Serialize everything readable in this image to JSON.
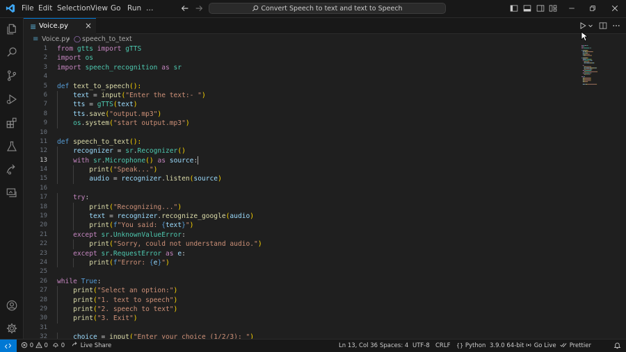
{
  "menu": [
    "File",
    "Edit",
    "Selection",
    "View",
    "Go",
    "Run"
  ],
  "more_menu": "…",
  "command_center": {
    "text": "Convert Speech to text and text to Speech"
  },
  "tab": {
    "label": "Voice.py",
    "close": "×"
  },
  "breadcrumb": {
    "file": "Voice.py",
    "separator": "›",
    "symbol": "speech_to_text"
  },
  "editor": {
    "current_line": 13,
    "line_numbers": [
      "1",
      "2",
      "3",
      "4",
      "5",
      "6",
      "7",
      "8",
      "9",
      "10",
      "11",
      "12",
      "13",
      "14",
      "15",
      "16",
      "17",
      "18",
      "19",
      "20",
      "21",
      "22",
      "23",
      "24",
      "25",
      "26",
      "27",
      "28",
      "29",
      "30",
      "31",
      "32"
    ],
    "lines": [
      [
        [
          "kw",
          "from"
        ],
        [
          "tx",
          " "
        ],
        [
          "cl",
          "gtts"
        ],
        [
          "tx",
          " "
        ],
        [
          "kw",
          "import"
        ],
        [
          "tx",
          " "
        ],
        [
          "cl",
          "gTTS"
        ]
      ],
      [
        [
          "kw",
          "import"
        ],
        [
          "tx",
          " "
        ],
        [
          "cl",
          "os"
        ]
      ],
      [
        [
          "kw",
          "import"
        ],
        [
          "tx",
          " "
        ],
        [
          "cl",
          "speech_recognition"
        ],
        [
          "tx",
          " "
        ],
        [
          "kw",
          "as"
        ],
        [
          "tx",
          " "
        ],
        [
          "cl",
          "sr"
        ]
      ],
      [],
      [
        [
          "def",
          "def"
        ],
        [
          "tx",
          " "
        ],
        [
          "fn",
          "text_to_speech"
        ],
        [
          "bk",
          "():"
        ]
      ],
      [
        [
          "tx",
          "    "
        ],
        [
          "vr",
          "text"
        ],
        [
          "tx",
          " = "
        ],
        [
          "fn",
          "input"
        ],
        [
          "bk",
          "("
        ],
        [
          "st",
          "\"Enter the text:- \""
        ],
        [
          "bk",
          ")"
        ]
      ],
      [
        [
          "tx",
          "    "
        ],
        [
          "vr",
          "tts"
        ],
        [
          "tx",
          " = "
        ],
        [
          "cl",
          "gTTS"
        ],
        [
          "bk",
          "("
        ],
        [
          "vr",
          "text"
        ],
        [
          "bk",
          ")"
        ]
      ],
      [
        [
          "tx",
          "    "
        ],
        [
          "vr",
          "tts"
        ],
        [
          "tx",
          "."
        ],
        [
          "fn",
          "save"
        ],
        [
          "bk",
          "("
        ],
        [
          "st",
          "\"output.mp3\""
        ],
        [
          "bk",
          ")"
        ]
      ],
      [
        [
          "tx",
          "    "
        ],
        [
          "cl",
          "os"
        ],
        [
          "tx",
          "."
        ],
        [
          "fn",
          "system"
        ],
        [
          "bk",
          "("
        ],
        [
          "st",
          "\"start output.mp3\""
        ],
        [
          "bk",
          ")"
        ]
      ],
      [],
      [
        [
          "def",
          "def"
        ],
        [
          "tx",
          " "
        ],
        [
          "fn",
          "speech_to_text"
        ],
        [
          "bk",
          "():"
        ]
      ],
      [
        [
          "tx",
          "    "
        ],
        [
          "vr",
          "recognizer"
        ],
        [
          "tx",
          " = "
        ],
        [
          "cl",
          "sr"
        ],
        [
          "tx",
          "."
        ],
        [
          "cl",
          "Recognizer"
        ],
        [
          "bk",
          "()"
        ]
      ],
      [
        [
          "tx",
          "    "
        ],
        [
          "kw",
          "with"
        ],
        [
          "tx",
          " "
        ],
        [
          "cl",
          "sr"
        ],
        [
          "tx",
          "."
        ],
        [
          "cl",
          "Microphone"
        ],
        [
          "bk",
          "()"
        ],
        [
          "tx",
          " "
        ],
        [
          "kw",
          "as"
        ],
        [
          "tx",
          " "
        ],
        [
          "vr",
          "source"
        ],
        [
          "tx",
          ":"
        ]
      ],
      [
        [
          "tx",
          "        "
        ],
        [
          "fn",
          "print"
        ],
        [
          "bk",
          "("
        ],
        [
          "st",
          "\"Speak...\""
        ],
        [
          "bk",
          ")"
        ]
      ],
      [
        [
          "tx",
          "        "
        ],
        [
          "vr",
          "audio"
        ],
        [
          "tx",
          " = "
        ],
        [
          "vr",
          "recognizer"
        ],
        [
          "tx",
          "."
        ],
        [
          "fn",
          "listen"
        ],
        [
          "bk",
          "("
        ],
        [
          "vr",
          "source"
        ],
        [
          "bk",
          ")"
        ]
      ],
      [],
      [
        [
          "tx",
          "    "
        ],
        [
          "kw",
          "try"
        ],
        [
          "tx",
          ":"
        ]
      ],
      [
        [
          "tx",
          "        "
        ],
        [
          "fn",
          "print"
        ],
        [
          "bk",
          "("
        ],
        [
          "st",
          "\"Recognizing...\""
        ],
        [
          "bk",
          ")"
        ]
      ],
      [
        [
          "tx",
          "        "
        ],
        [
          "vr",
          "text"
        ],
        [
          "tx",
          " = "
        ],
        [
          "vr",
          "recognizer"
        ],
        [
          "tx",
          "."
        ],
        [
          "fn",
          "recognize_google"
        ],
        [
          "bk",
          "("
        ],
        [
          "vr",
          "audio"
        ],
        [
          "bk",
          ")"
        ]
      ],
      [
        [
          "tx",
          "        "
        ],
        [
          "fn",
          "print"
        ],
        [
          "bk",
          "("
        ],
        [
          "def",
          "f"
        ],
        [
          "st",
          "\"You said: "
        ],
        [
          "def",
          "{"
        ],
        [
          "vr",
          "text"
        ],
        [
          "def",
          "}"
        ],
        [
          "st",
          "\""
        ],
        [
          "bk",
          ")"
        ]
      ],
      [
        [
          "tx",
          "    "
        ],
        [
          "kw",
          "except"
        ],
        [
          "tx",
          " "
        ],
        [
          "cl",
          "sr"
        ],
        [
          "tx",
          "."
        ],
        [
          "cl",
          "UnknownValueError"
        ],
        [
          "tx",
          ":"
        ]
      ],
      [
        [
          "tx",
          "        "
        ],
        [
          "fn",
          "print"
        ],
        [
          "bk",
          "("
        ],
        [
          "st",
          "\"Sorry, could not understand audio.\""
        ],
        [
          "bk",
          ")"
        ]
      ],
      [
        [
          "tx",
          "    "
        ],
        [
          "kw",
          "except"
        ],
        [
          "tx",
          " "
        ],
        [
          "cl",
          "sr"
        ],
        [
          "tx",
          "."
        ],
        [
          "cl",
          "RequestError"
        ],
        [
          "tx",
          " "
        ],
        [
          "kw",
          "as"
        ],
        [
          "tx",
          " "
        ],
        [
          "vr",
          "e"
        ],
        [
          "tx",
          ":"
        ]
      ],
      [
        [
          "tx",
          "        "
        ],
        [
          "fn",
          "print"
        ],
        [
          "bk",
          "("
        ],
        [
          "def",
          "f"
        ],
        [
          "st",
          "\"Error: "
        ],
        [
          "def",
          "{"
        ],
        [
          "vr",
          "e"
        ],
        [
          "def",
          "}"
        ],
        [
          "st",
          "\""
        ],
        [
          "bk",
          ")"
        ]
      ],
      [],
      [
        [
          "kw",
          "while"
        ],
        [
          "tx",
          " "
        ],
        [
          "def",
          "True"
        ],
        [
          "tx",
          ":"
        ]
      ],
      [
        [
          "tx",
          "    "
        ],
        [
          "fn",
          "print"
        ],
        [
          "bk",
          "("
        ],
        [
          "st",
          "\"Select an option:\""
        ],
        [
          "bk",
          ")"
        ]
      ],
      [
        [
          "tx",
          "    "
        ],
        [
          "fn",
          "print"
        ],
        [
          "bk",
          "("
        ],
        [
          "st",
          "\"1. text to speech\""
        ],
        [
          "bk",
          ")"
        ]
      ],
      [
        [
          "tx",
          "    "
        ],
        [
          "fn",
          "print"
        ],
        [
          "bk",
          "("
        ],
        [
          "st",
          "\"2. speech to text\""
        ],
        [
          "bk",
          ")"
        ]
      ],
      [
        [
          "tx",
          "    "
        ],
        [
          "fn",
          "print"
        ],
        [
          "bk",
          "("
        ],
        [
          "st",
          "\"3. Exit\""
        ],
        [
          "bk",
          ")"
        ]
      ],
      [],
      [
        [
          "tx",
          "    "
        ],
        [
          "vr",
          "choice"
        ],
        [
          "tx",
          " = "
        ],
        [
          "fn",
          "input"
        ],
        [
          "bk",
          "("
        ],
        [
          "st",
          "\"Enter your choice (1/2/3): \""
        ],
        [
          "bk",
          ")"
        ]
      ]
    ]
  },
  "status": {
    "errors": "0",
    "warnings": "0",
    "ports": "0",
    "live_share": "Live Share",
    "position": "Ln 13, Col 36",
    "spaces": "Spaces: 4",
    "encoding": "UTF-8",
    "eol": "CRLF",
    "language": "Python",
    "interpreter": "3.9.0 64-bit",
    "go_live": "Go Live",
    "prettier": "Prettier"
  },
  "colors": {
    "accent": "#0078d4",
    "keyword": "#c586c0",
    "storage": "#569cd6",
    "function": "#dcdcaa",
    "variable": "#9cdcfe",
    "string": "#ce9178",
    "class": "#4ec9b0",
    "bracket": "#ffd700"
  },
  "icons": {
    "app": "vscode-logo-icon",
    "activity": [
      "explorer-icon",
      "search-icon",
      "source-control-icon",
      "run-debug-icon",
      "extensions-icon",
      "testing-icon",
      "remote-explorer-icon",
      "live-share-icon",
      "accounts-icon",
      "manage-gear-icon"
    ]
  }
}
